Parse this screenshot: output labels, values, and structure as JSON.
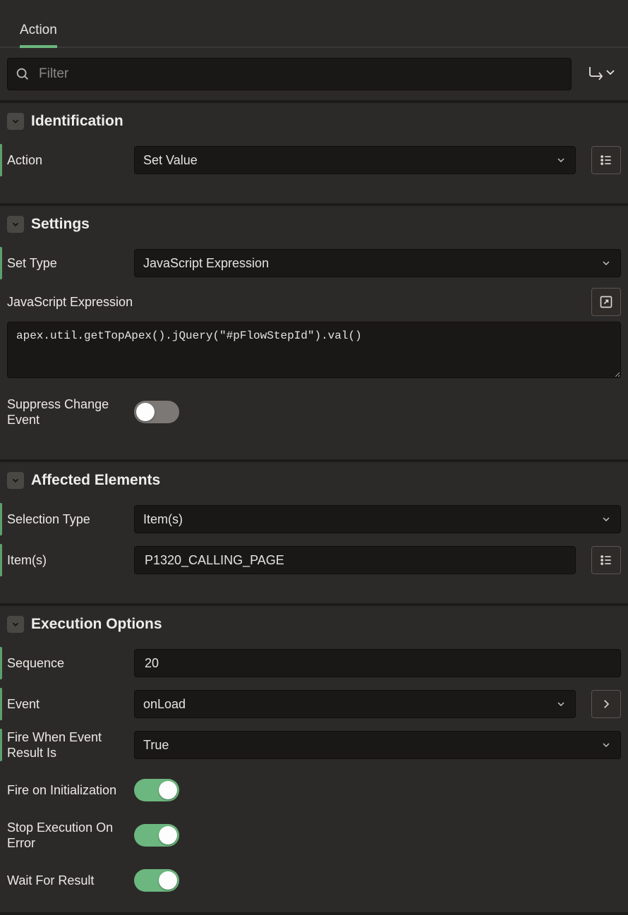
{
  "tabs": {
    "action": "Action"
  },
  "filter": {
    "placeholder": "Filter"
  },
  "sections": {
    "identification": {
      "title": "Identification",
      "fields": {
        "action_label": "Action",
        "action_value": "Set Value"
      }
    },
    "settings": {
      "title": "Settings",
      "fields": {
        "set_type_label": "Set Type",
        "set_type_value": "JavaScript Expression",
        "js_expr_label": "JavaScript Expression",
        "js_expr_value": "apex.util.getTopApex().jQuery(\"#pFlowStepId\").val()",
        "suppress_change_label": "Suppress Change Event",
        "suppress_change_value": false
      }
    },
    "affected": {
      "title": "Affected Elements",
      "fields": {
        "selection_type_label": "Selection Type",
        "selection_type_value": "Item(s)",
        "items_label": "Item(s)",
        "items_value": "P1320_CALLING_PAGE"
      }
    },
    "execution": {
      "title": "Execution Options",
      "fields": {
        "sequence_label": "Sequence",
        "sequence_value": "20",
        "event_label": "Event",
        "event_value": "onLoad",
        "fire_when_label": "Fire When Event Result Is",
        "fire_when_value": "True",
        "fire_on_init_label": "Fire on Initialization",
        "fire_on_init_value": true,
        "stop_on_error_label": "Stop Execution On Error",
        "stop_on_error_value": true,
        "wait_for_result_label": "Wait For Result",
        "wait_for_result_value": true
      }
    }
  }
}
